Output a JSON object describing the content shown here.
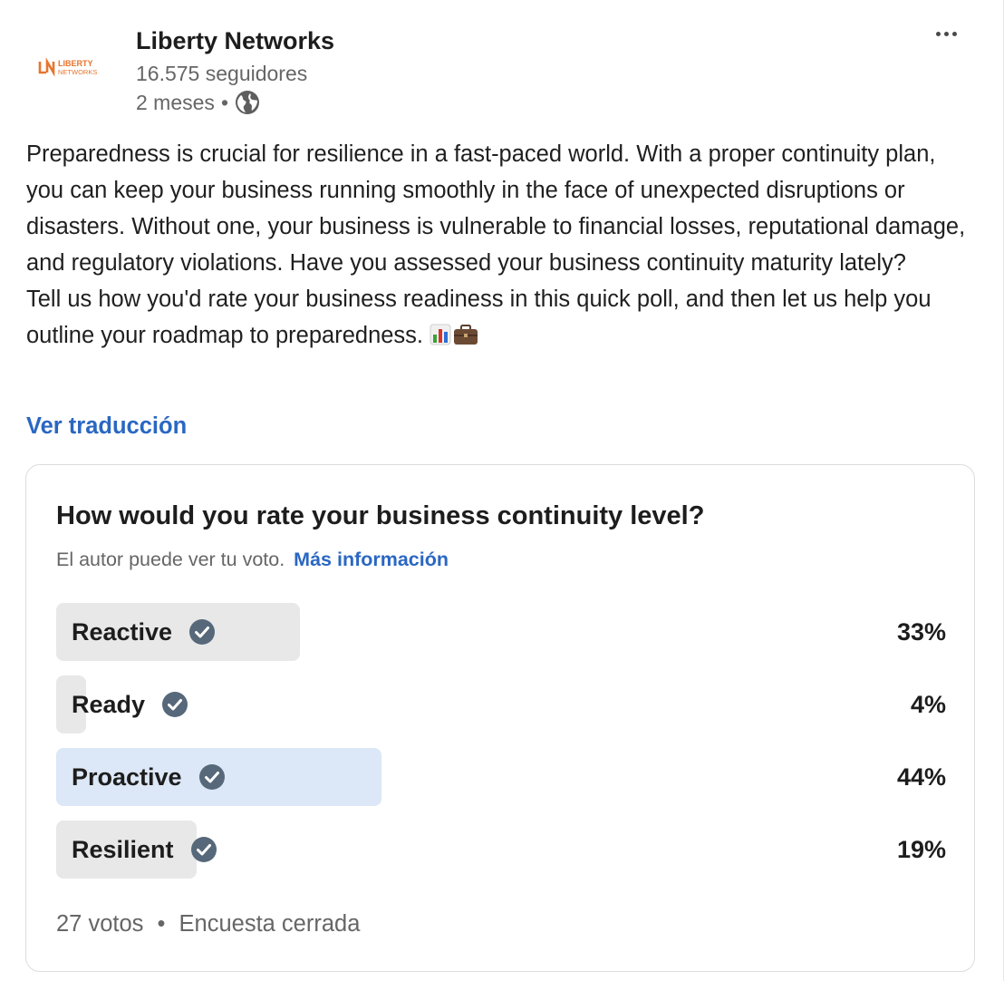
{
  "company": {
    "name": "Liberty Networks",
    "followers": "16.575 seguidores",
    "time_ago": "2 meses",
    "separator": "•",
    "logo_text_line1": "LIBERTY",
    "logo_text_line2": "NETWORKS",
    "logo_monogram": "LN"
  },
  "post": {
    "paragraph1": "Preparedness is crucial for resilience in a fast-paced world. With a proper continuity plan, you can keep your business running smoothly in the face of unexpected disruptions or disasters. Without one, your business is vulnerable to financial losses, reputational damage, and regulatory violations. Have you assessed your business continuity maturity lately?",
    "paragraph2": "Tell us how you'd rate your business readiness in this quick poll, and then let us help you outline your roadmap to preparedness.",
    "emojis": [
      "bar-chart-emoji",
      "briefcase-emoji"
    ],
    "translate_label": "Ver traducción"
  },
  "poll": {
    "question": "How would you rate your business continuity level?",
    "notice": "El autor puede ver tu voto.",
    "more_info": "Más información",
    "options": [
      {
        "label": "Reactive",
        "percent_label": "33%",
        "percent": 33,
        "highlight": false
      },
      {
        "label": "Ready",
        "percent_label": "4%",
        "percent": 4,
        "highlight": false
      },
      {
        "label": "Proactive",
        "percent_label": "44%",
        "percent": 44,
        "highlight": true
      },
      {
        "label": "Resilient",
        "percent_label": "19%",
        "percent": 19,
        "highlight": false
      }
    ],
    "votes": "27 votos",
    "status": "Encuesta cerrada",
    "separator": "•"
  },
  "icons": {
    "globe": "globe-icon",
    "check": "check-circle-icon",
    "more": "more-options-icon"
  },
  "colors": {
    "link": "#2a67c2",
    "bar_default": "#e8e8e8",
    "bar_top": "#dce7f7",
    "logo_orange": "#e8742c"
  }
}
